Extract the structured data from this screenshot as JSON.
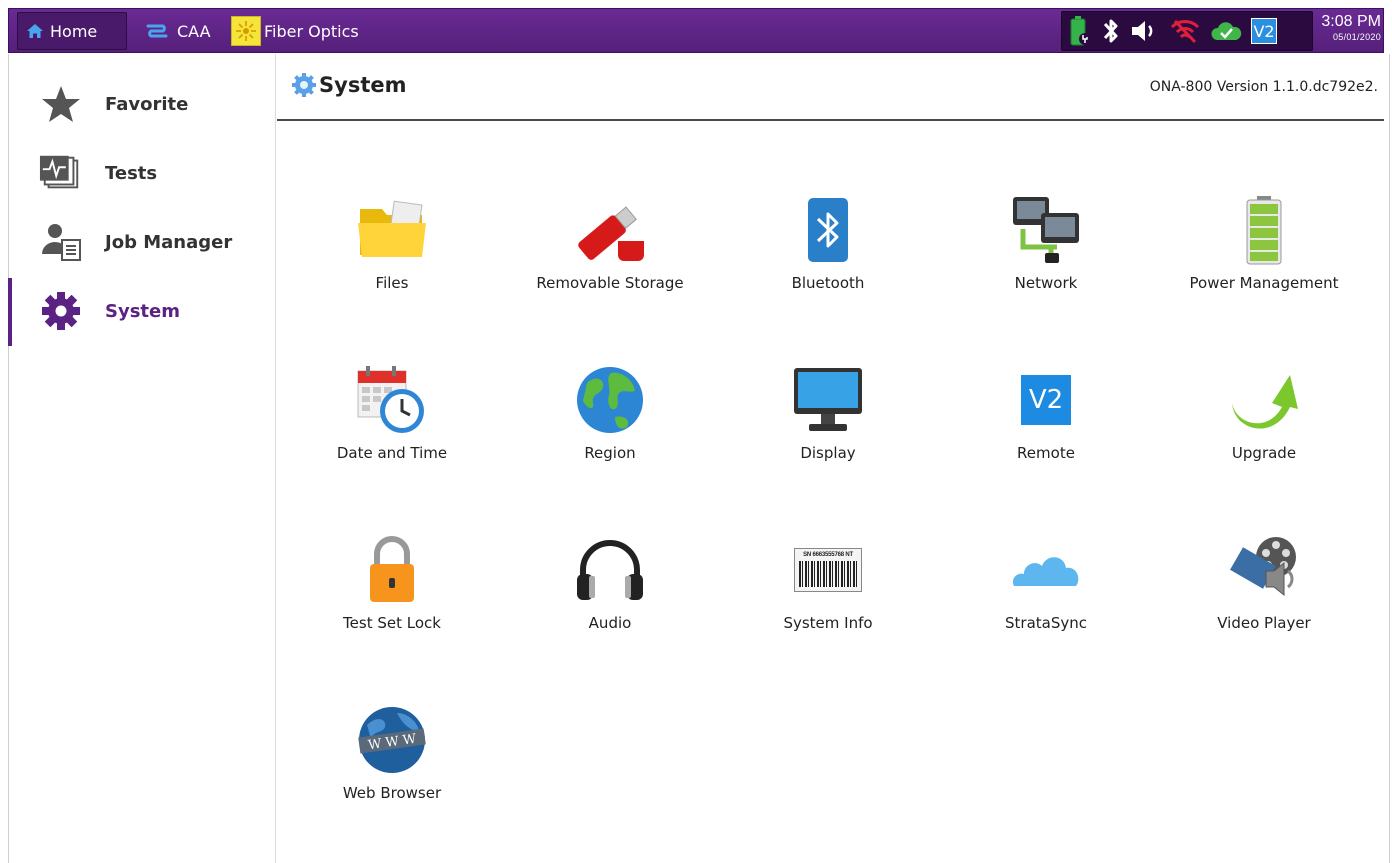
{
  "topbar": {
    "home_label": "Home",
    "caa_label": "CAA",
    "fiber_label": "Fiber Optics",
    "status_icons": [
      "battery-charging-icon",
      "bluetooth-icon",
      "speaker-icon",
      "wifi-off-icon",
      "cloud-check-icon",
      "vnc-icon"
    ],
    "time": "3:08 PM",
    "date": "05/01/2020"
  },
  "sidebar": {
    "items": [
      {
        "label": "Favorite",
        "icon": "star-icon"
      },
      {
        "label": "Tests",
        "icon": "tests-icon"
      },
      {
        "label": "Job Manager",
        "icon": "job-manager-icon"
      },
      {
        "label": "System",
        "icon": "gear-icon",
        "active": true
      }
    ]
  },
  "header": {
    "title": "System",
    "version": "ONA-800 Version 1.1.0.dc792e2."
  },
  "tiles": [
    {
      "label": "Files",
      "icon": "folder-icon"
    },
    {
      "label": "Removable Storage",
      "icon": "usb-drive-icon"
    },
    {
      "label": "Bluetooth",
      "icon": "bluetooth-icon"
    },
    {
      "label": "Network",
      "icon": "network-icon"
    },
    {
      "label": "Power Management",
      "icon": "battery-icon"
    },
    {
      "label": "Date and Time",
      "icon": "calendar-clock-icon"
    },
    {
      "label": "Region",
      "icon": "globe-icon"
    },
    {
      "label": "Display",
      "icon": "monitor-icon"
    },
    {
      "label": "Remote",
      "icon": "vnc-icon"
    },
    {
      "label": "Upgrade",
      "icon": "upgrade-arrow-icon"
    },
    {
      "label": "Test Set Lock",
      "icon": "lock-icon"
    },
    {
      "label": "Audio",
      "icon": "headphones-icon"
    },
    {
      "label": "System Info",
      "icon": "barcode-icon"
    },
    {
      "label": "StrataSync",
      "icon": "cloud-icon"
    },
    {
      "label": "Video Player",
      "icon": "film-reel-icon"
    },
    {
      "label": "Web Browser",
      "icon": "www-globe-icon"
    }
  ],
  "system_info_serial": "SN 6663555768 NT",
  "remote_logo": "V2",
  "colors": {
    "topbar": "#5b2183",
    "active_accent": "#5b2183",
    "status_area": "#2b0a40"
  }
}
